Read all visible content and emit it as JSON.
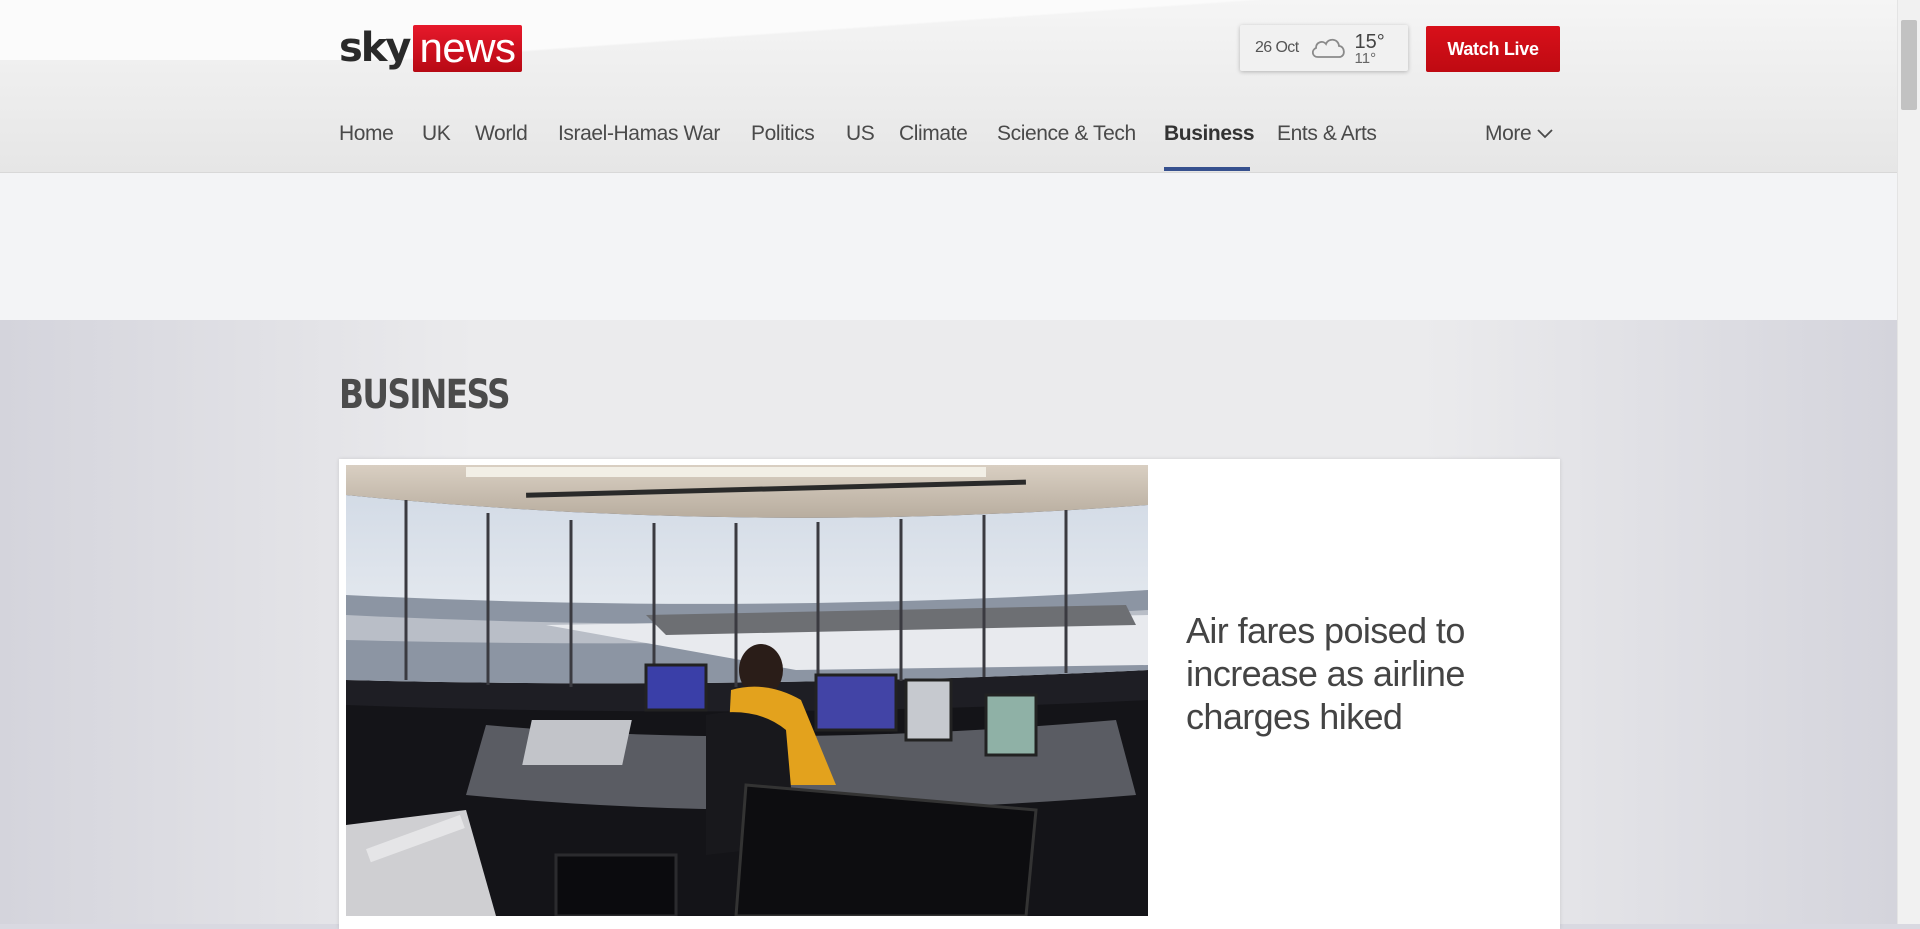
{
  "header": {
    "logo": {
      "sky": "sky",
      "news": "news"
    },
    "weather": {
      "date": "26 Oct",
      "icon": "cloud-icon",
      "high": "15°",
      "low": "11°"
    },
    "watch_live_label": "Watch Live"
  },
  "nav": {
    "items": [
      {
        "label": "Home"
      },
      {
        "label": "UK"
      },
      {
        "label": "World"
      },
      {
        "label": "Israel-Hamas War"
      },
      {
        "label": "Politics"
      },
      {
        "label": "US"
      },
      {
        "label": "Climate"
      },
      {
        "label": "Science & Tech"
      },
      {
        "label": "Business",
        "active": true
      },
      {
        "label": "Ents & Arts"
      }
    ],
    "more_label": "More",
    "active_color": "#36508e"
  },
  "page": {
    "section_title": "BUSINESS"
  },
  "lead_story": {
    "headline": "Air fares poised to increase as airline charges hiked",
    "image": "air-traffic-control-tower-photo"
  },
  "colors": {
    "brand_red": "#d8101a",
    "nav_active_underline": "#36508e"
  }
}
